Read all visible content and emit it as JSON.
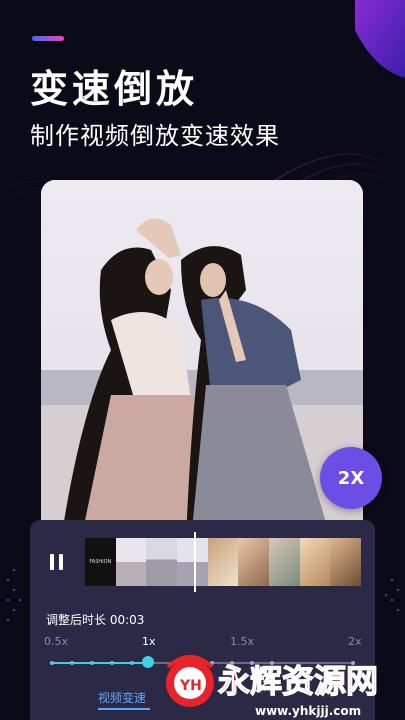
{
  "hero": {
    "title": "变速倒放",
    "subtitle": "制作视频倒放变速效果"
  },
  "badge": {
    "speed": "2X"
  },
  "editor": {
    "duration_label": "调整后时长 00:03",
    "speed_ticks": [
      "0.5x",
      "1x",
      "1.5x",
      "2x"
    ],
    "selected_speed": "1x",
    "tab_label": "视频变速",
    "frame_cover_text": "FASHION",
    "playhead_progress": 0.37
  },
  "watermark": {
    "brand_text": "永辉资源网",
    "domain_text": "www.yhkjjj.com",
    "logo_text": "YH"
  },
  "colors": {
    "background": "#0b0a18",
    "accent": "#6a4ee6",
    "slider_active": "#3fd0e6",
    "tab_active": "#5aa7ff",
    "watermark_red": "#e8232a"
  }
}
